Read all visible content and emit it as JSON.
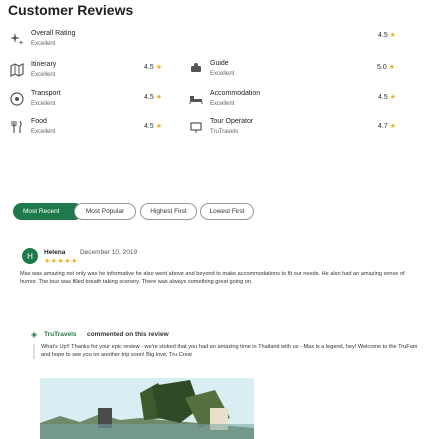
{
  "page": {
    "title": "Customer Reviews"
  },
  "overall": {
    "name": "Overall Rating",
    "sub": "Excellent",
    "score": "4.5"
  },
  "ratings": [
    {
      "name": "Itinerary",
      "sub": "Excellent",
      "score": "4.5",
      "icon": "map-icon"
    },
    {
      "name": "Guide",
      "sub": "Excellent",
      "score": "5.0",
      "icon": "guide-icon"
    },
    {
      "name": "Transport",
      "sub": "Excellent",
      "score": "4.5",
      "icon": "transport-icon"
    },
    {
      "name": "Accommodation",
      "sub": "Excellent",
      "score": "4.5",
      "icon": "bed-icon"
    },
    {
      "name": "Food",
      "sub": "Excellent",
      "score": "4.5",
      "icon": "food-icon"
    },
    {
      "name": "Tour Operator",
      "sub": "TruTravels",
      "score": "4.7",
      "icon": "operator-icon"
    }
  ],
  "filters": {
    "active": "Most Recent",
    "options": [
      "Most Popular",
      "Highest First",
      "Lowest First"
    ]
  },
  "review": {
    "initial": "H",
    "author": "Helena",
    "date": "December 10, 2019",
    "stars": "★★★★★",
    "text": "Max was amazing not only was he informative he also went above and beyond to make accommodations to fit our needs. He also had an amazing sense of humor. The tour was filled breath taking scenery. There was always something great going on.",
    "owner_name": "TruTravels",
    "owner_action": "commented on this review",
    "reply": "What's Up!! Thanks for your epic review - we're stoked that you had an amazing time in Thailand with us - Max is a legend, hey! Welcome to the TruFam and hope to see you on another trip soon! Big love, Tru Crew"
  },
  "colors": {
    "accent": "#1e7a4a",
    "star": "#f2b01e"
  }
}
